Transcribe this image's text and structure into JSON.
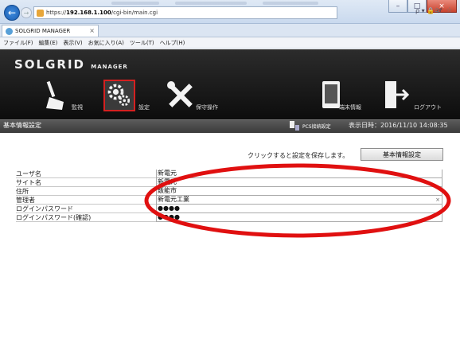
{
  "browser": {
    "url_prefix": "https://",
    "url_host": "192.168.1.100",
    "url_path": "/cgi-bin/main.cgi",
    "address_tools": "ρ ▾ 🔒 ♂",
    "right_icons": "⌂ ☆ ⚙",
    "tab": {
      "title": "SOLGRID MANAGER",
      "close": "×"
    },
    "window_buttons": {
      "minimize": "–",
      "maximize": "□",
      "close": "×"
    },
    "menu": [
      "ファイル(F)",
      "編集(E)",
      "表示(V)",
      "お気に入り(A)",
      "ツール(T)",
      "ヘルプ(H)"
    ]
  },
  "app": {
    "logo_main": "SOLGRID",
    "logo_sub": "MANAGER",
    "nav": {
      "monitor": "監視",
      "settings": "設定",
      "maintenance": "保守操作",
      "terminal_info": "端末情報",
      "logout": "ログアウト"
    },
    "page_title": "基本情報設定",
    "pcs_label": "PCS接続設定",
    "datetime": "表示日時：2016/11/10 14:08:35",
    "save_hint": "クリックすると設定を保存します。",
    "save_button": "基本情報設定",
    "form": [
      {
        "label": "ユーザ名",
        "value": "新電元"
      },
      {
        "label": "サイト名",
        "value": "新電元"
      },
      {
        "label": "住所",
        "value": "飯能市"
      },
      {
        "label": "管理者",
        "value": "新電元工業",
        "clear": "×"
      },
      {
        "label": "ログインパスワード",
        "value": "●●●●"
      },
      {
        "label": "ログインパスワード(確認)",
        "value": "●●●●"
      }
    ]
  },
  "colors": {
    "header_bg": "#111111",
    "annotation_red": "#e01010",
    "settings_border": "#d42020"
  }
}
